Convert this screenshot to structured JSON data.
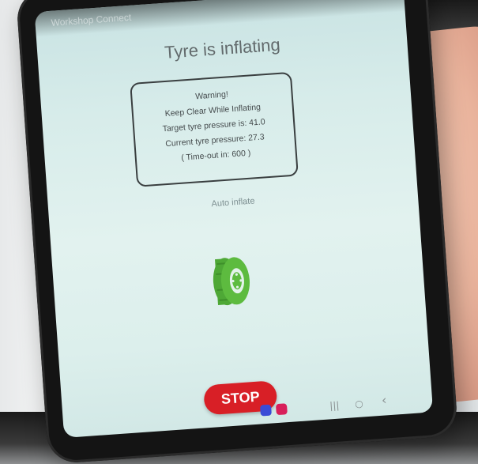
{
  "app": {
    "title": "Workshop Connect"
  },
  "screen": {
    "title": "Tyre is inflating",
    "warning_lines": [
      "Warning!",
      "Keep Clear While Inflating",
      "Target tyre pressure is: 41.0",
      "Current tyre pressure: 27.3",
      "( Time-out in: 600 )"
    ],
    "mode_label": "Auto inflate",
    "stop_label": "STOP"
  },
  "navbar": {
    "recents_icon": "|||",
    "home_icon": "○",
    "back_icon": "‹"
  },
  "colors": {
    "accent_red": "#d81f26",
    "tyre_green": "#5dbb3f"
  },
  "icons": [
    "tyre-icon",
    "recents-icon",
    "home-icon",
    "back-icon"
  ]
}
